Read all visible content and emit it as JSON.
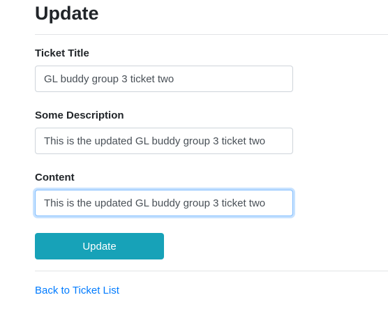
{
  "page": {
    "title": "Update"
  },
  "form": {
    "ticket_title": {
      "label": "Ticket Title",
      "value": "GL buddy group 3 ticket two"
    },
    "description": {
      "label": "Some Description",
      "value": "This is the updated GL buddy group 3 ticket two"
    },
    "content": {
      "label": "Content",
      "value": "This is the updated GL buddy group 3 ticket two",
      "focused": true
    },
    "submit_label": "Update"
  },
  "links": {
    "back": "Back to Ticket List"
  },
  "colors": {
    "button_bg": "#17a2b8",
    "link": "#007bff",
    "focus_border": "#80bdff"
  }
}
